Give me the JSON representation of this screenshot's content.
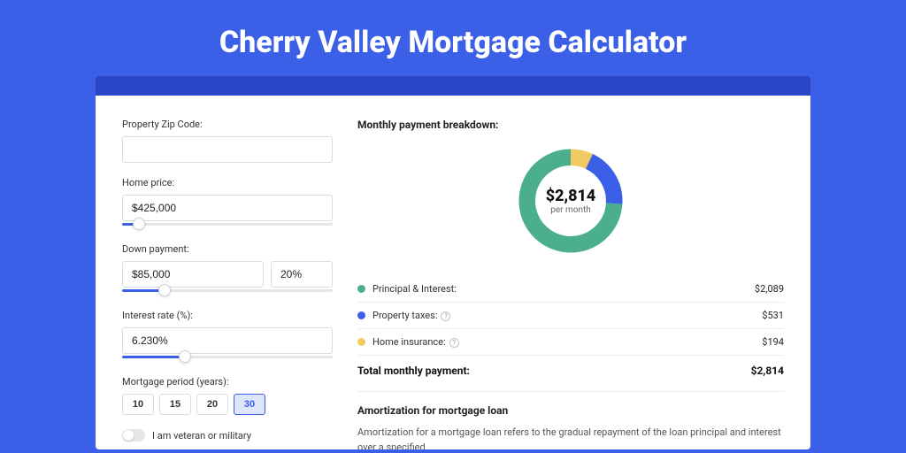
{
  "title": "Cherry Valley Mortgage Calculator",
  "form": {
    "zip": {
      "label": "Property Zip Code:",
      "value": ""
    },
    "home_price": {
      "label": "Home price:",
      "value": "$425,000",
      "slider_pct": 8
    },
    "down_payment": {
      "label": "Down payment:",
      "value": "$85,000",
      "pct_value": "20%",
      "slider_pct": 20
    },
    "interest_rate": {
      "label": "Interest rate (%):",
      "value": "6.230%",
      "slider_pct": 30
    },
    "period": {
      "label": "Mortgage period (years):",
      "options": [
        "10",
        "15",
        "20",
        "30"
      ],
      "active": "30"
    },
    "veteran": {
      "label": "I am veteran or military",
      "on": false
    }
  },
  "breakdown": {
    "heading": "Monthly payment breakdown:",
    "center_amount": "$2,814",
    "center_sub": "per month",
    "items": [
      {
        "label": "Principal & Interest:",
        "value": "$2,089",
        "color": "#4BAF8E",
        "info": false,
        "pct": 74
      },
      {
        "label": "Property taxes:",
        "value": "$531",
        "color": "#3C5FE8",
        "info": true,
        "pct": 19
      },
      {
        "label": "Home insurance:",
        "value": "$194",
        "color": "#EFCB62",
        "info": true,
        "pct": 7
      }
    ],
    "total_label": "Total monthly payment:",
    "total_value": "$2,814"
  },
  "amortization": {
    "title": "Amortization for mortgage loan",
    "text": "Amortization for a mortgage loan refers to the gradual repayment of the loan principal and interest over a specified"
  },
  "chart_data": {
    "type": "pie",
    "title": "Monthly payment breakdown",
    "series": [
      {
        "name": "Principal & Interest",
        "value": 2089,
        "color": "#4BAF8E"
      },
      {
        "name": "Property taxes",
        "value": 531,
        "color": "#3C5FE8"
      },
      {
        "name": "Home insurance",
        "value": 194,
        "color": "#EFCB62"
      }
    ],
    "total": 2814,
    "center_label": "$2,814 per month"
  }
}
